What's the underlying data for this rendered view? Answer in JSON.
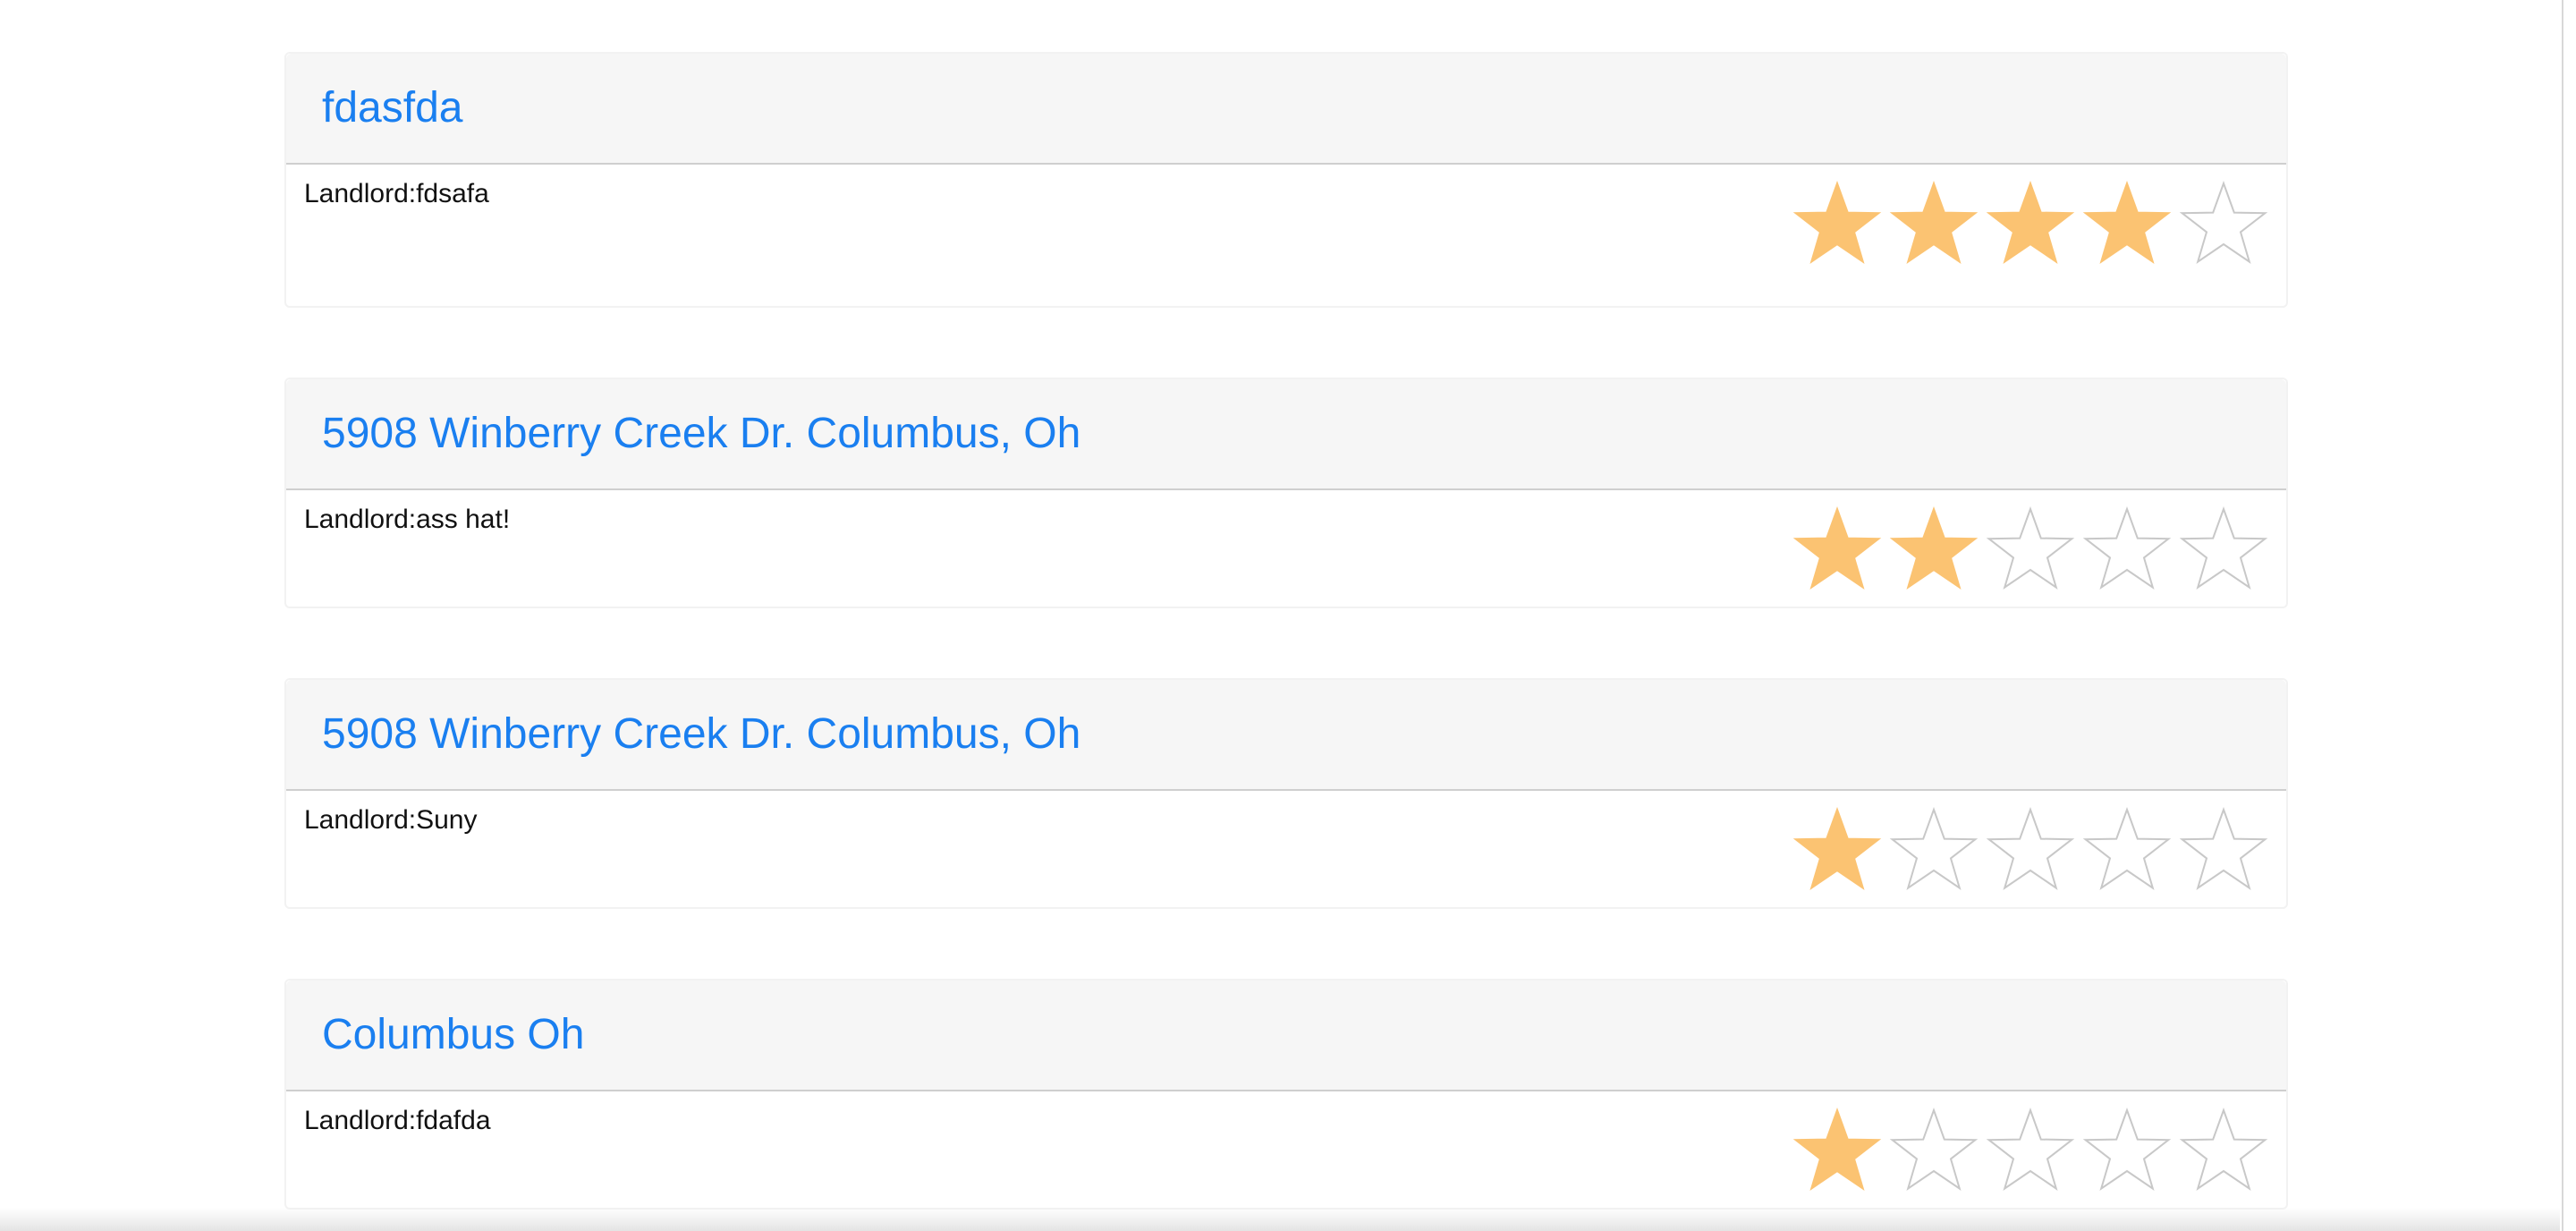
{
  "colors": {
    "title_link": "#1a7ff0",
    "star_filled": "#fbc372",
    "star_empty_stroke": "#c8c8c8",
    "header_bg": "#f6f6f6"
  },
  "listings": [
    {
      "title": "fdasfda",
      "landlord": "Landlord:fdsafa",
      "rating": 4,
      "max_rating": 5
    },
    {
      "title": "5908 Winberry Creek Dr. Columbus, Oh",
      "landlord": "Landlord:ass hat!",
      "rating": 2,
      "max_rating": 5
    },
    {
      "title": "5908 Winberry Creek Dr. Columbus, Oh",
      "landlord": "Landlord:Suny",
      "rating": 1,
      "max_rating": 5
    },
    {
      "title": "Columbus Oh",
      "landlord": "Landlord:fdafda",
      "rating": 1,
      "max_rating": 5
    }
  ]
}
